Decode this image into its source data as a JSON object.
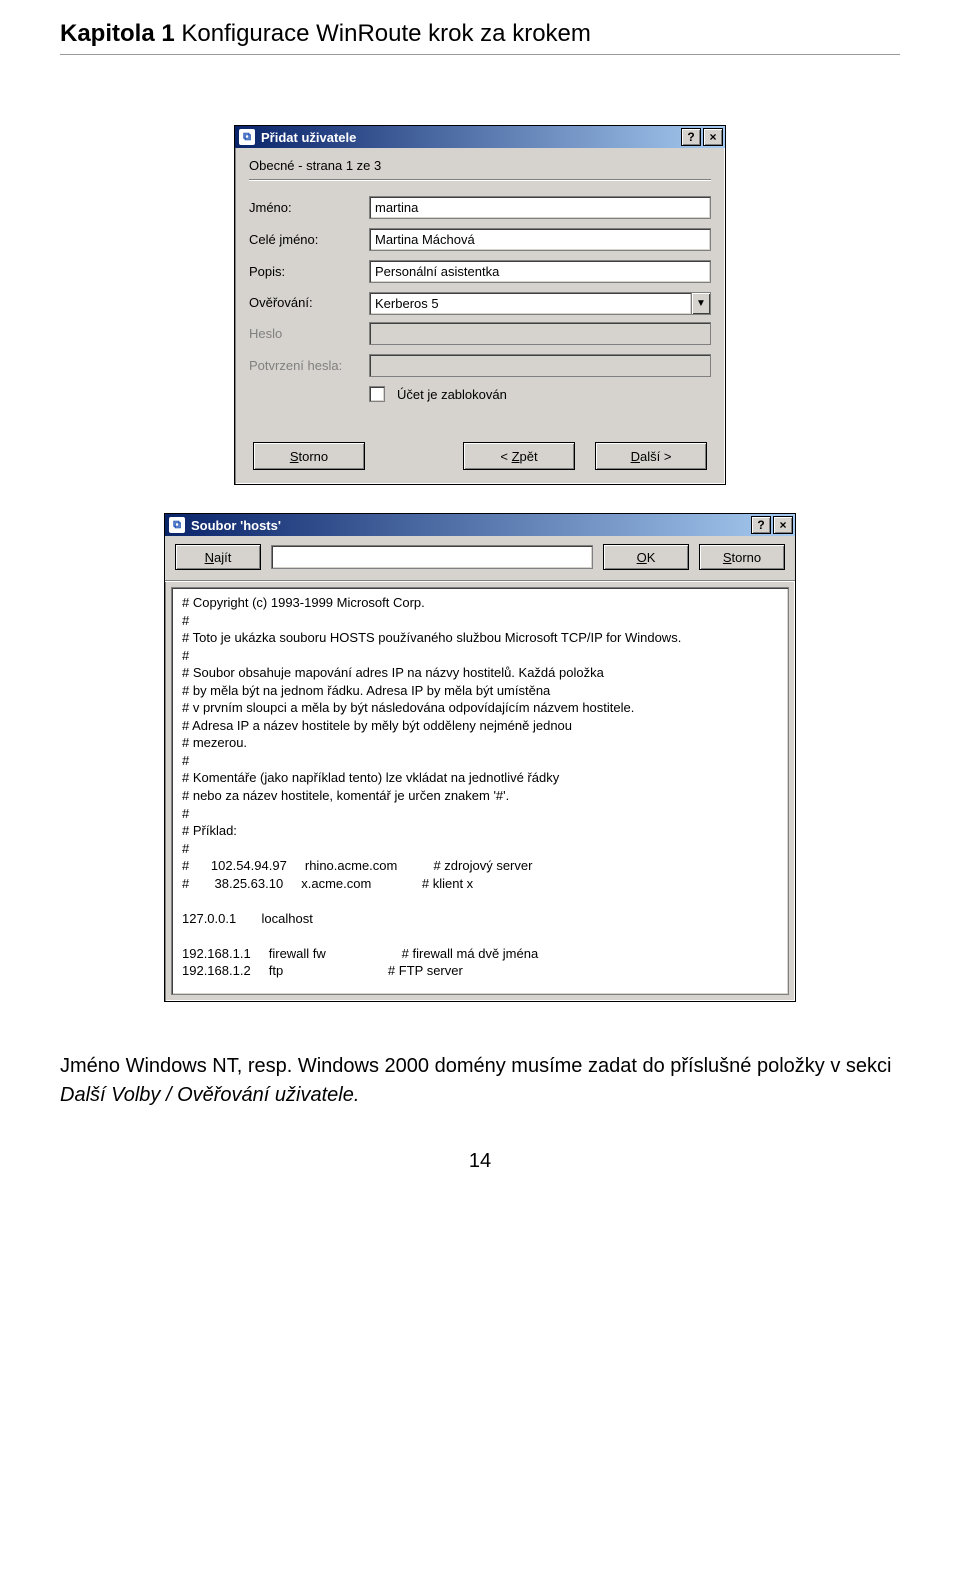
{
  "page": {
    "chapter_prefix": "Kapitola 1",
    "chapter_title": "Konfigurace WinRoute krok za krokem",
    "number": "14"
  },
  "dlg1": {
    "title": "Přidat uživatele",
    "help_btn": "?",
    "close_btn": "×",
    "subheader": "Obecné - strana 1 ze 3",
    "labels": {
      "jmeno": "Jméno:",
      "cele_jmeno": "Celé jméno:",
      "popis": "Popis:",
      "overovani": "Ověřování:",
      "heslo": "Heslo",
      "potvrzeni": "Potvrzení hesla:",
      "ucet_zablokovan": "Účet je zablokován"
    },
    "values": {
      "jmeno": "martina",
      "cele_jmeno": "Martina Máchová",
      "popis": "Personální asistentka",
      "overovani": "Kerberos 5"
    },
    "buttons": {
      "storno": "Storno",
      "zpet_lt": "<",
      "zpet": "Zpět",
      "dalsi": "Další",
      "dalsi_gt": ">"
    }
  },
  "dlg2": {
    "title": "Soubor 'hosts'",
    "help_btn": "?",
    "close_btn": "×",
    "toolbar": {
      "najit": "Najít",
      "ok": "OK",
      "storno": "Storno"
    },
    "hosts_text": "# Copyright (c) 1993-1999 Microsoft Corp.\n#\n# Toto je ukázka souboru HOSTS používaného službou Microsoft TCP/IP for Windows.\n#\n# Soubor obsahuje mapování adres IP na názvy hostitelů. Každá položka\n# by měla být na jednom řádku. Adresa IP by měla být umístěna\n# v prvním sloupci a měla by být následována odpovídajícím názvem hostitele.\n# Adresa IP a název hostitele by měly být odděleny nejméně jednou\n# mezerou.\n#\n# Komentáře (jako například tento) lze vkládat na jednotlivé řádky\n# nebo za název hostitele, komentář je určen znakem '#'.\n#\n# Příklad:\n#\n#      102.54.94.97     rhino.acme.com          # zdrojový server\n#       38.25.63.10     x.acme.com              # klient x\n\n127.0.0.1       localhost\n\n192.168.1.1     firewall fw                     # firewall má dvě jména\n192.168.1.2     ftp                             # FTP server"
  },
  "caption": {
    "pre": "Jméno Windows NT, resp. Windows 2000 domény musíme zadat do příslušné položky v sekci ",
    "ital": "Další Volby / Ověřování uživatele."
  }
}
